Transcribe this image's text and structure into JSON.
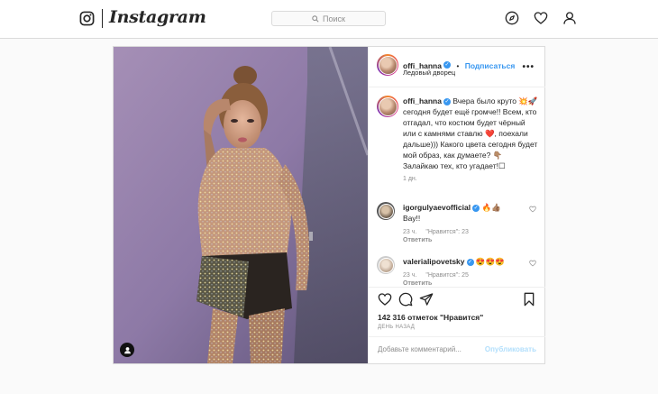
{
  "nav": {
    "wordmark": "Instagram",
    "search_placeholder": "Поиск",
    "icons": [
      "instagram-logo-icon",
      "search-icon",
      "explore-compass-icon",
      "activity-heart-icon",
      "profile-icon"
    ]
  },
  "post": {
    "author": {
      "username": "offi_hanna",
      "verified": true,
      "follow_label": "Подписаться",
      "separator": "•",
      "location": "Ледовый дворец"
    },
    "caption": {
      "username": "offi_hanna",
      "text": "Вчера было круто 💥🚀 сегодня будет ещё громче!! Всем, кто отгадал, что костюм будет чёрный или с камнями ставлю ❤️, поехали дальше))) Какого цвета сегодня будет мой образ, как думаете? 👇🏽 Залайкаю тех, кто угадает!☐",
      "time": "1 дн."
    },
    "comments": [
      {
        "username": "igorgulyaevofficial",
        "verified": true,
        "text": "🔥👍🏽",
        "reply": "Вау!!",
        "time": "23 ч.",
        "likes": "\"Нравится\": 23",
        "reply_label": "Ответить"
      },
      {
        "username": "valerialipovetsky",
        "verified": true,
        "text": "😍😍😍",
        "time": "23 ч.",
        "likes": "\"Нравится\": 25",
        "reply_label": "Ответить"
      }
    ],
    "likes_text": "142 316 отметок \"Нравится\"",
    "date": "ДЕНЬ НАЗАД",
    "comment_placeholder": "Добавьте комментарий...",
    "publish_label": "Опубликовать"
  },
  "colors": {
    "link_blue": "#3897f0",
    "publish_disabled": "#b2dffc",
    "border": "#dbdbdb",
    "background": "#fafafa",
    "like_red": "#ed4956"
  }
}
